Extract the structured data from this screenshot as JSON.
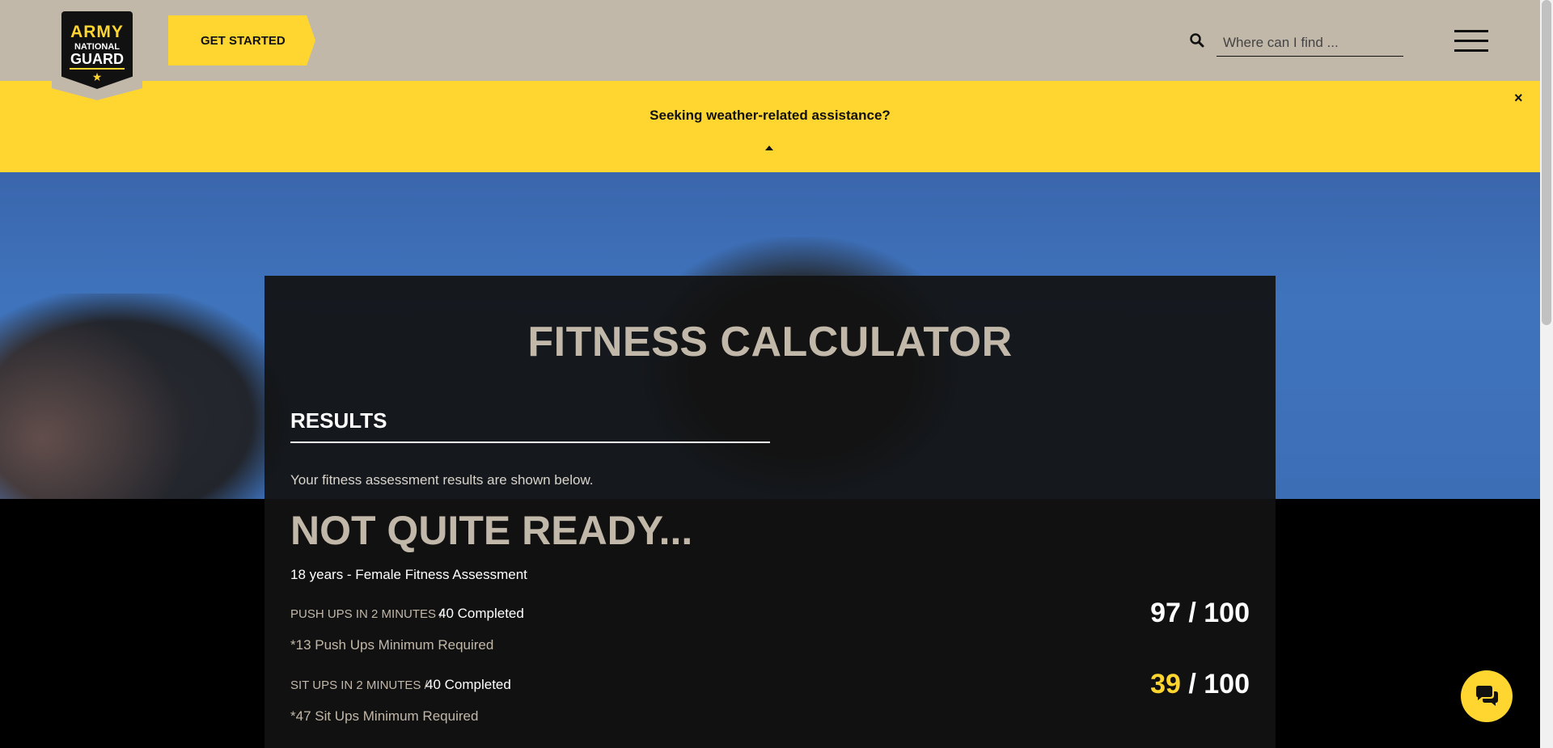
{
  "header": {
    "logo": {
      "line1": "ARMY",
      "line2": "NATIONAL",
      "line3": "GUARD",
      "icon": "star-icon"
    },
    "get_started_label": "GET STARTED",
    "search": {
      "placeholder": "Where can I find ...",
      "value": "",
      "icon": "search-icon"
    },
    "menu_icon": "hamburger-menu-icon"
  },
  "alert": {
    "text": "Seeking weather-related assistance?",
    "close_label": "×",
    "toggle_icon": "caret-up-icon"
  },
  "calculator": {
    "title": "FITNESS CALCULATOR",
    "results_heading": "RESULTS",
    "results_description": "Your fitness assessment results are shown below.",
    "status": "NOT QUITE READY...",
    "assessment": "18 years - Female Fitness Assessment",
    "rows": [
      {
        "label": "PUSH UPS IN 2 MINUTES /",
        "completed": "40 Completed",
        "minimum": "*13 Push Ups Minimum Required",
        "score": "97",
        "out_of": "/ 100",
        "score_color": "#ffffff"
      },
      {
        "label": "SIT UPS IN 2 MINUTES /",
        "completed": "40 Completed",
        "minimum": "*47 Sit Ups Minimum Required",
        "score": "39",
        "out_of": "/ 100",
        "score_color": "#ffd530"
      }
    ]
  },
  "chat": {
    "icon": "chat-bubbles-icon"
  },
  "colors": {
    "tan": "#c2b8a9",
    "yellow": "#ffd530",
    "panel": "#121212"
  }
}
